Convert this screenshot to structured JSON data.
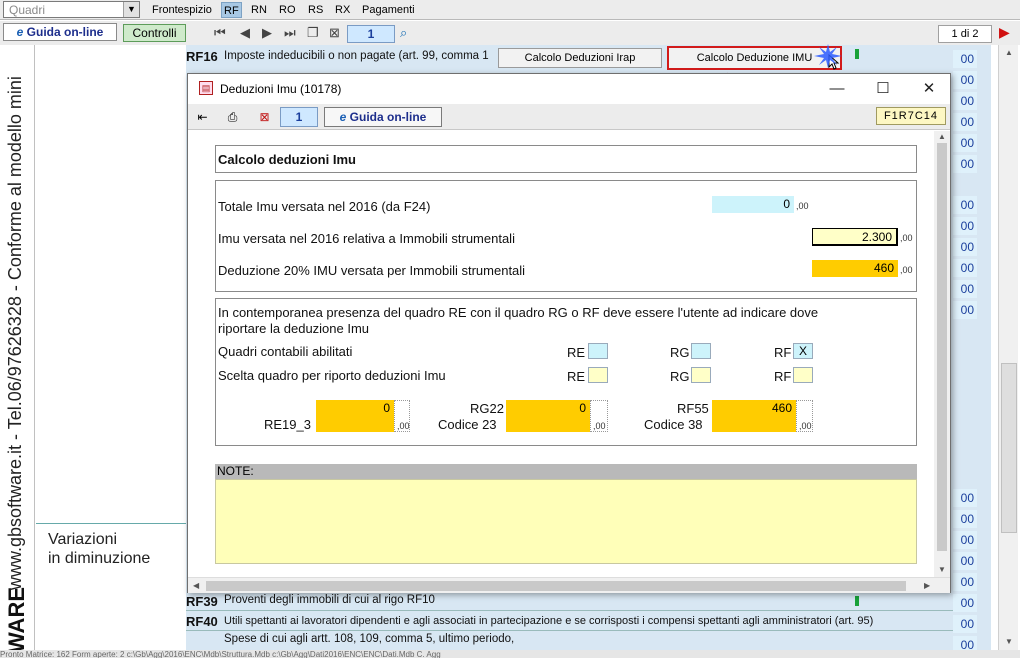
{
  "topbar": {
    "quadri_select": "Quadri",
    "tabs": [
      "Frontespizio",
      "RF",
      "RN",
      "RO",
      "RS",
      "RX",
      "Pagamenti"
    ],
    "active_tab": "RF"
  },
  "toolbar": {
    "guida_label": "Guida on-line",
    "controlli_label": "Controlli",
    "page_number": "1",
    "page_of": "1 di 2"
  },
  "sidebar": {
    "vertical_text": "www.gbsoftware.it - Tel.06/97626328 - Conforme al modello mini",
    "brand_fragment": "WARE",
    "section_label_line1": "Variazioni",
    "section_label_line2": "in diminuzione"
  },
  "main": {
    "rf16": {
      "code": "RF16",
      "text": "Imposte indeducibili o non pagate (art. 99, comma 1"
    },
    "rf39": {
      "code": "RF39",
      "text": "Proventi degli immobili di cui al rigo RF10"
    },
    "rf40": {
      "code": "RF40",
      "text": "Utili spettanti ai lavoratori dipendenti e agli associati in partecipazione e se corrisposti i compensi spettanti agli amministratori (art. 95)"
    },
    "rf41_text": "Spese di cui agli artt. 108, 109, comma 5, ultimo periodo,",
    "zero_value": "00",
    "calc_irap_label": "Calcolo Deduzioni Irap",
    "calc_imu_label": "Calcolo Deduzione IMU",
    "status_text": "Pronto          Matrice: 162          Form aperte: 2          c:\\Gb\\Agg\\2016\\ENC\\Mdb\\Struttura.Mdb  c:\\Gb\\Agg\\Dati2016\\ENC\\ENC\\Dati.Mdb  C. Agg"
  },
  "dialog": {
    "title": "Deduzioni Imu (10178)",
    "page": "1",
    "guida_label": "Guida on-line",
    "code": "F1R7C14",
    "section_title": "Calcolo deduzioni Imu",
    "totale_label": "Totale Imu versata nel 2016 (da F24)",
    "totale_value": "0",
    "strumentali_label": "Imu versata nel 2016 relativa a Immobili strumentali",
    "strumentali_value": "2.300",
    "deduzione_label": "Deduzione 20% IMU versata per Immobili strumentali",
    "deduzione_value": "460",
    "decimal": ",00",
    "info_line1": "In contemporanea presenza del quadro RE con il quadro RG o RF deve essere l'utente ad indicare dove",
    "info_line2": "riportare la deduzione Imu",
    "abilitati_label": "Quadri contabili abilitati",
    "scelta_label": "Scelta quadro per riporto deduzioni Imu",
    "re_label": "RE",
    "rg_label": "RG",
    "rf_label": "RF",
    "rf_abilitato": "X",
    "re19_label": "RE19_3",
    "re19_value": "0",
    "rg22_label": "RG22",
    "rg22_code": "Codice 23",
    "rg22_value": "0",
    "rf55_label": "RF55",
    "rf55_code": "Codice 38",
    "rf55_value": "460",
    "note_label": "NOTE:"
  }
}
